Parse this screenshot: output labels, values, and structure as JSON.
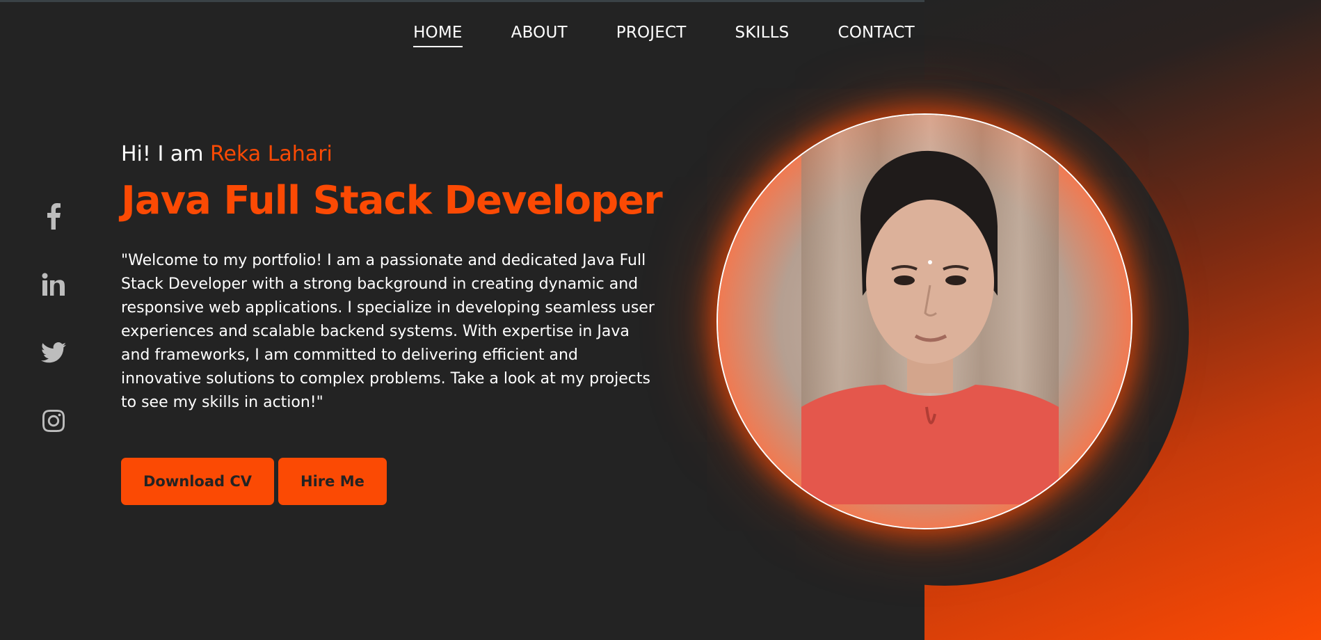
{
  "nav": {
    "items": [
      {
        "label": "HOME",
        "active": true
      },
      {
        "label": "ABOUT",
        "active": false
      },
      {
        "label": "PROJECT",
        "active": false
      },
      {
        "label": "SKILLS",
        "active": false
      },
      {
        "label": "CONTACT",
        "active": false
      }
    ]
  },
  "social": {
    "icons": [
      "facebook-icon",
      "linkedin-icon",
      "twitter-icon",
      "instagram-icon"
    ]
  },
  "hero": {
    "greeting_prefix": "Hi! I am ",
    "name": "Reka Lahari",
    "title": "Java Full Stack Developer",
    "intro": "\"Welcome to my portfolio! I am a passionate and dedicated Java Full Stack Developer with a strong background in creating dynamic and responsive web applications. I specialize in developing seamless user experiences and scalable backend systems. With expertise in Java and frameworks, I am committed to delivering efficient and innovative solutions to complex problems. Take a look at my projects to see my skills in action!\"",
    "buttons": {
      "download_cv": "Download CV",
      "hire_me": "Hire Me"
    }
  },
  "colors": {
    "accent": "#fb4a04",
    "background": "#232323",
    "text": "#ffffff",
    "icon": "#bdbdbd"
  }
}
